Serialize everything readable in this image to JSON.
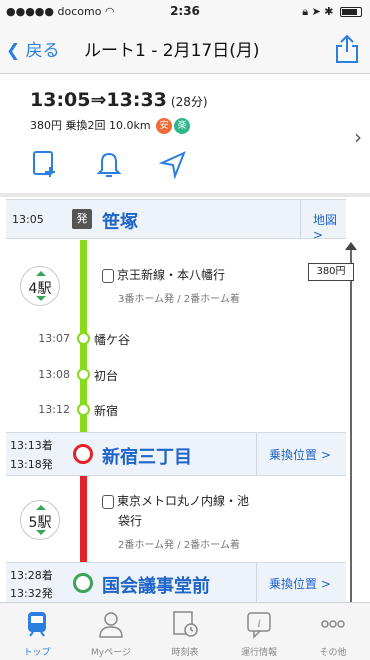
{
  "status": {
    "carrier": "docomo",
    "time": "2:36",
    "battery_text": ""
  },
  "nav": {
    "back_label": "戻る",
    "title": "ルート1 - 2月17日(月)"
  },
  "summary": {
    "depart": "13:05",
    "arrive": "13:33",
    "duration": "(28分)",
    "fare": "380円",
    "transfers": "乗換2回",
    "distance": "10.0km",
    "badge1": "安",
    "badge2": "楽"
  },
  "route": {
    "origin": {
      "time": "13:05",
      "name": "笹塚",
      "map_label": "地図 >",
      "mark": "発"
    },
    "fare_tag": "380円",
    "leg1": {
      "stations_count": "4駅",
      "line": "京王新線・本八幡行",
      "platform": "3番ホーム発 / 2番ホーム着",
      "stops": [
        {
          "time": "13:07",
          "name": "幡ケ谷"
        },
        {
          "time": "13:08",
          "name": "初台"
        },
        {
          "time": "13:12",
          "name": "新宿"
        }
      ]
    },
    "transfer1": {
      "arr": "13:13着",
      "dep": "13:18発",
      "name": "新宿三丁目",
      "link": "乗換位置 >"
    },
    "leg2": {
      "stations_count": "5駅",
      "line_a": "東京メトロ丸ノ内線・池",
      "line_b": "袋行",
      "platform": "2番ホーム発 / 2番ホーム着"
    },
    "transfer2": {
      "arr": "13:28着",
      "dep": "13:32発",
      "name": "国会議事堂前",
      "link": "乗換位置 >"
    }
  },
  "tabs": [
    {
      "label": "トップ"
    },
    {
      "label": "Myページ"
    },
    {
      "label": "時刻表"
    },
    {
      "label": "運行情報"
    },
    {
      "label": "その他"
    }
  ],
  "colors": {
    "accent": "#2a7fe0",
    "green_line": "#8ad81f",
    "red_line": "#e0242a",
    "teal_line": "#3ba35a"
  }
}
